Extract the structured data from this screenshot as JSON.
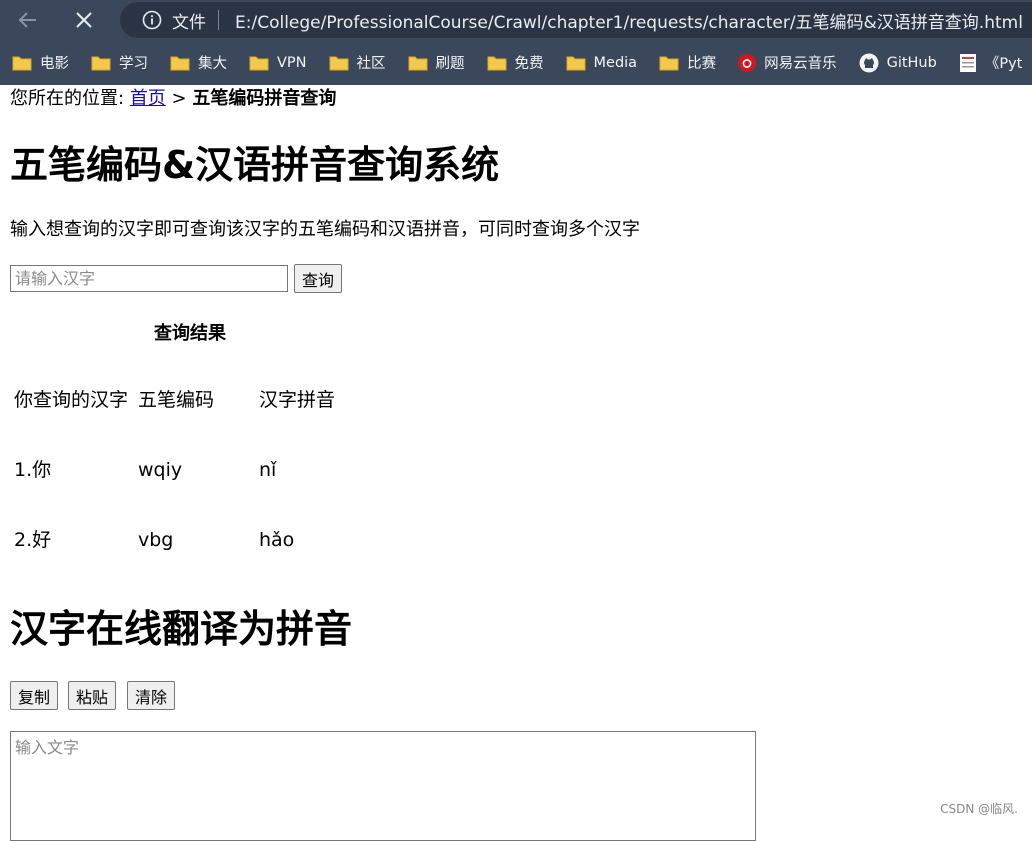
{
  "browser": {
    "url_scheme_label": "文件",
    "url": "E:/College/ProfessionalCourse/Crawl/chapter1/requests/character/五笔编码&汉语拼音查询.html",
    "bookmarks": [
      {
        "label": "电影",
        "icon": "folder-icon"
      },
      {
        "label": "学习",
        "icon": "folder-icon"
      },
      {
        "label": "集大",
        "icon": "folder-icon"
      },
      {
        "label": "VPN",
        "icon": "folder-icon"
      },
      {
        "label": "社区",
        "icon": "folder-icon"
      },
      {
        "label": "刷题",
        "icon": "folder-icon"
      },
      {
        "label": "免费",
        "icon": "folder-icon"
      },
      {
        "label": "Media",
        "icon": "folder-icon"
      },
      {
        "label": "比赛",
        "icon": "folder-icon"
      },
      {
        "label": "网易云音乐",
        "icon": "netease-music-icon"
      },
      {
        "label": "GitHub",
        "icon": "github-icon"
      },
      {
        "label": "《Pyt",
        "icon": "page-icon"
      }
    ]
  },
  "page": {
    "breadcrumb": {
      "prefix": "您所在的位置:",
      "home_link": "首页",
      "separator": ">",
      "current": "五笔编码拼音查询"
    },
    "title1": "五笔编码&汉语拼音查询系统",
    "description": "输入想查询的汉字即可查询该汉字的五笔编码和汉语拼音，可同时查询多个汉字",
    "search": {
      "placeholder": "请输入汉字",
      "button": "查询"
    },
    "results": {
      "caption": "查询结果",
      "headers": [
        "你查询的汉字",
        "五笔编码",
        "汉字拼音"
      ],
      "rows": [
        [
          "1.你",
          "wqiy",
          "nǐ"
        ],
        [
          "2.好",
          "vbg",
          "hǎo"
        ]
      ]
    },
    "title2": "汉字在线翻译为拼音",
    "buttons": {
      "copy": "复制",
      "paste": "粘贴",
      "clear": "清除"
    },
    "textarea_placeholder": "输入文字",
    "watermark": "CSDN @临风."
  }
}
